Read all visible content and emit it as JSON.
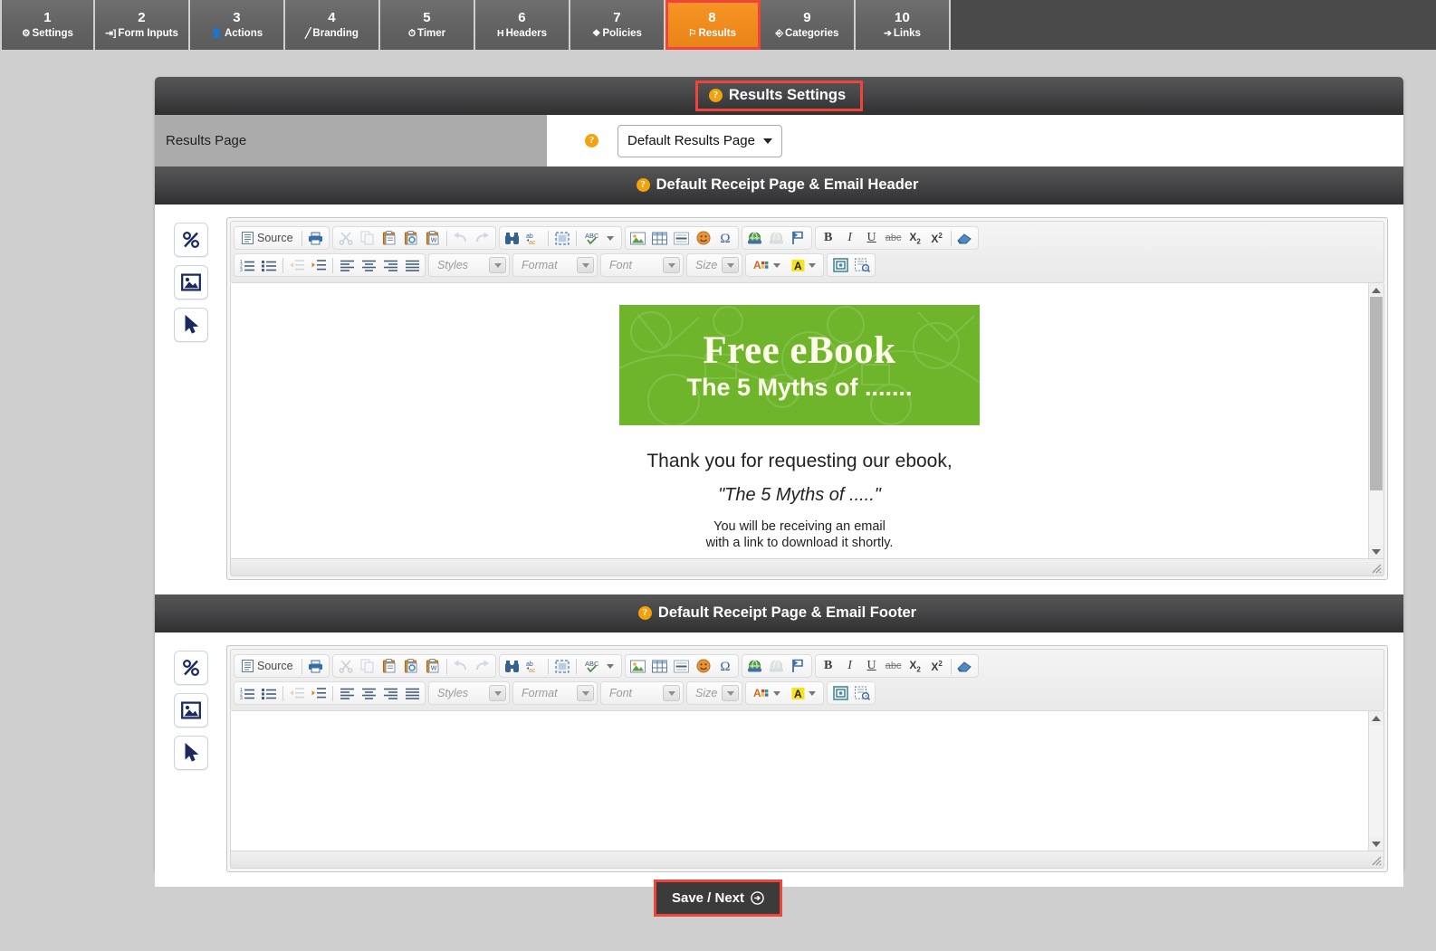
{
  "tabs": [
    {
      "num": "1",
      "label": "Settings",
      "icon": "gear-icon",
      "active": false
    },
    {
      "num": "2",
      "label": "Form Inputs",
      "icon": "signin-icon",
      "active": false
    },
    {
      "num": "3",
      "label": "Actions",
      "icon": "user-icon",
      "active": false
    },
    {
      "num": "4",
      "label": "Branding",
      "icon": "brush-icon",
      "active": false
    },
    {
      "num": "5",
      "label": "Timer",
      "icon": "clock-icon",
      "active": false
    },
    {
      "num": "6",
      "label": "Headers",
      "icon": "heading-icon",
      "active": false
    },
    {
      "num": "7",
      "label": "Policies",
      "icon": "pushpin-icon",
      "active": false
    },
    {
      "num": "8",
      "label": "Results",
      "icon": "flag-icon",
      "active": true
    },
    {
      "num": "9",
      "label": "Categories",
      "icon": "sitemap-icon",
      "active": false
    },
    {
      "num": "10",
      "label": "Links",
      "icon": "cursor-icon",
      "active": false
    }
  ],
  "panel": {
    "title": "Results Settings",
    "results_page": {
      "label": "Results Page",
      "selected": "Default Results Page",
      "options": [
        "Default Results Page"
      ]
    },
    "header_section_title": "Default Receipt Page & Email Header",
    "footer_section_title": "Default Receipt Page & Email Footer"
  },
  "side_buttons": [
    {
      "name": "percent-icon",
      "title": "Percent"
    },
    {
      "name": "image-icon",
      "title": "Image"
    },
    {
      "name": "cursor-icon",
      "title": "Cursor"
    }
  ],
  "editor_toolbar": {
    "source_label": "Source",
    "row1": [
      {
        "group": [
          "source",
          "print"
        ]
      },
      {
        "group": [
          "cut",
          "copy",
          "paste",
          "paste-text",
          "paste-word",
          "undo",
          "redo"
        ]
      },
      {
        "group": [
          "find",
          "replace",
          "select-all",
          "spellcheck"
        ]
      },
      {
        "group": [
          "image",
          "table",
          "horizontal-rule",
          "smiley",
          "special-char"
        ]
      },
      {
        "group": [
          "link",
          "unlink",
          "anchor"
        ]
      },
      {
        "group": [
          "bold",
          "italic",
          "underline",
          "strikethrough",
          "subscript",
          "superscript",
          "remove-format"
        ]
      }
    ],
    "row2": [
      {
        "group": [
          "numbered-list",
          "bulleted-list",
          "outdent",
          "indent",
          "align-left",
          "align-center",
          "align-right",
          "justify"
        ]
      }
    ],
    "combos": [
      {
        "name": "styles-combo",
        "placeholder": "Styles"
      },
      {
        "name": "format-combo",
        "placeholder": "Format"
      },
      {
        "name": "font-combo",
        "placeholder": "Font"
      },
      {
        "name": "size-combo",
        "placeholder": "Size"
      }
    ],
    "color_buttons": [
      "text-color",
      "background-color"
    ],
    "tools": [
      "maximize",
      "show-blocks"
    ]
  },
  "header_document": {
    "banner_line1": "Free eBook",
    "banner_line2": "The 5 Myths of .......",
    "banner_color": "#6eb52b",
    "paragraph1": "Thank you for requesting our ebook,",
    "paragraph2": "\"The 5 Myths of .....\"",
    "paragraph3_line1": "You will be receiving an email",
    "paragraph3_line2": "with a link to download it shortly."
  },
  "footer_document": {
    "content": ""
  },
  "save": {
    "label": "Save / Next",
    "icon": "arrow-circle-right-icon"
  },
  "colors": {
    "accent": "#f2a20c",
    "active_tab": "#f08a1c",
    "highlight": "#f0443b",
    "banner_green": "#6eb52b"
  }
}
